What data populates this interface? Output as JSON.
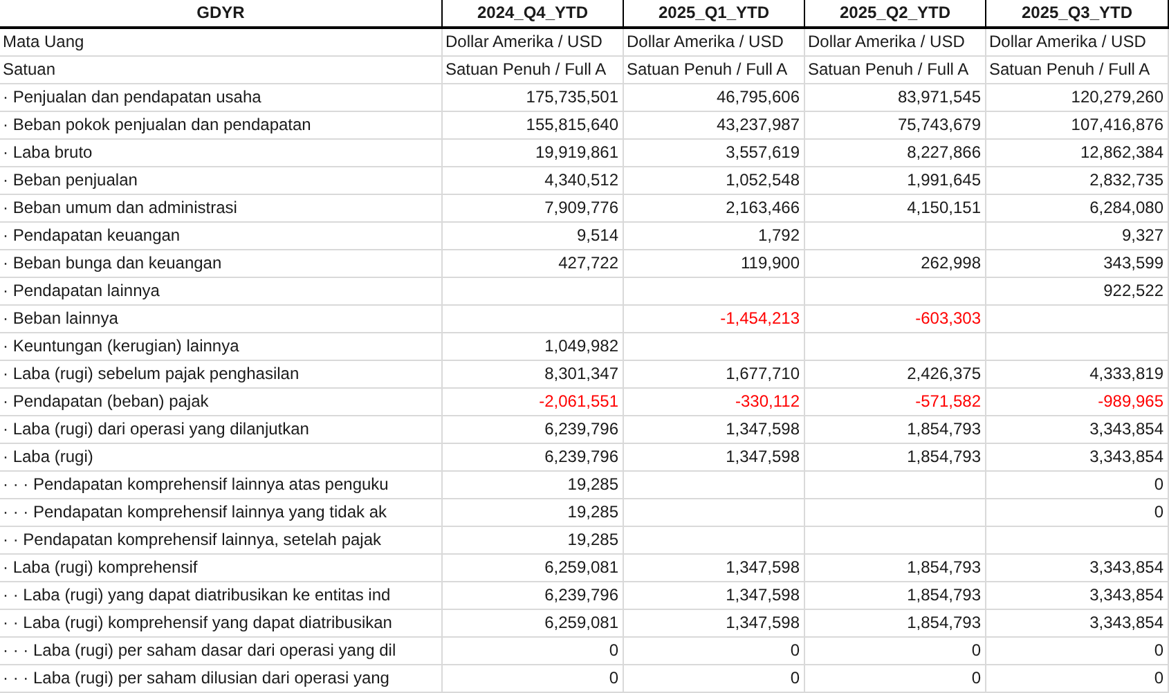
{
  "columns": [
    "GDYR",
    "2024_Q4_YTD",
    "2025_Q1_YTD",
    "2025_Q2_YTD",
    "2025_Q3_YTD"
  ],
  "meta_rows": [
    {
      "label": "Mata Uang",
      "values": [
        "Dollar Amerika / USD",
        "Dollar Amerika / USD",
        "Dollar Amerika / USD",
        "Dollar Amerika / USD"
      ]
    },
    {
      "label": "Satuan",
      "values": [
        "Satuan Penuh / Full A",
        "Satuan Penuh / Full A",
        "Satuan Penuh / Full A",
        "Satuan Penuh / Full A"
      ]
    }
  ],
  "rows": [
    {
      "label": "· Penjualan dan pendapatan usaha",
      "col_1": {
        "text": "175,735,501",
        "negative": false
      },
      "col_2": {
        "text": "46,795,606",
        "negative": false
      },
      "col_3": {
        "text": "83,971,545",
        "negative": false
      },
      "col_4": {
        "text": "120,279,260",
        "negative": false
      }
    },
    {
      "label": "· Beban pokok penjualan dan pendapatan",
      "col_1": {
        "text": "155,815,640",
        "negative": false
      },
      "col_2": {
        "text": "43,237,987",
        "negative": false
      },
      "col_3": {
        "text": "75,743,679",
        "negative": false
      },
      "col_4": {
        "text": "107,416,876",
        "negative": false
      }
    },
    {
      "label": "· Laba bruto",
      "col_1": {
        "text": "19,919,861",
        "negative": false
      },
      "col_2": {
        "text": "3,557,619",
        "negative": false
      },
      "col_3": {
        "text": "8,227,866",
        "negative": false
      },
      "col_4": {
        "text": "12,862,384",
        "negative": false
      }
    },
    {
      "label": "· Beban penjualan",
      "col_1": {
        "text": "4,340,512",
        "negative": false
      },
      "col_2": {
        "text": "1,052,548",
        "negative": false
      },
      "col_3": {
        "text": "1,991,645",
        "negative": false
      },
      "col_4": {
        "text": "2,832,735",
        "negative": false
      }
    },
    {
      "label": "· Beban umum dan administrasi",
      "col_1": {
        "text": "7,909,776",
        "negative": false
      },
      "col_2": {
        "text": "2,163,466",
        "negative": false
      },
      "col_3": {
        "text": "4,150,151",
        "negative": false
      },
      "col_4": {
        "text": "6,284,080",
        "negative": false
      }
    },
    {
      "label": "· Pendapatan keuangan",
      "col_1": {
        "text": "9,514",
        "negative": false
      },
      "col_2": {
        "text": "1,792",
        "negative": false
      },
      "col_4": {
        "text": "9,327",
        "negative": false
      }
    },
    {
      "label": "· Beban bunga dan keuangan",
      "col_1": {
        "text": "427,722",
        "negative": false
      },
      "col_2": {
        "text": "119,900",
        "negative": false
      },
      "col_3": {
        "text": "262,998",
        "negative": false
      },
      "col_4": {
        "text": "343,599",
        "negative": false
      }
    },
    {
      "label": "· Pendapatan lainnya",
      "col_4": {
        "text": "922,522",
        "negative": false
      }
    },
    {
      "label": "· Beban lainnya",
      "col_2": {
        "text": "-1,454,213",
        "negative": true
      },
      "col_3": {
        "text": "-603,303",
        "negative": true
      }
    },
    {
      "label": "· Keuntungan (kerugian) lainnya",
      "col_1": {
        "text": "1,049,982",
        "negative": false
      }
    },
    {
      "label": "· Laba (rugi) sebelum pajak penghasilan",
      "col_1": {
        "text": "8,301,347",
        "negative": false
      },
      "col_2": {
        "text": "1,677,710",
        "negative": false
      },
      "col_3": {
        "text": "2,426,375",
        "negative": false
      },
      "col_4": {
        "text": "4,333,819",
        "negative": false
      }
    },
    {
      "label": "· Pendapatan (beban) pajak",
      "col_1": {
        "text": "-2,061,551",
        "negative": true
      },
      "col_2": {
        "text": "-330,112",
        "negative": true
      },
      "col_3": {
        "text": "-571,582",
        "negative": true
      },
      "col_4": {
        "text": "-989,965",
        "negative": true
      }
    },
    {
      "label": "· Laba (rugi) dari operasi yang dilanjutkan",
      "col_1": {
        "text": "6,239,796",
        "negative": false
      },
      "col_2": {
        "text": "1,347,598",
        "negative": false
      },
      "col_3": {
        "text": "1,854,793",
        "negative": false
      },
      "col_4": {
        "text": "3,343,854",
        "negative": false
      }
    },
    {
      "label": "· Laba (rugi)",
      "col_1": {
        "text": "6,239,796",
        "negative": false
      },
      "col_2": {
        "text": "1,347,598",
        "negative": false
      },
      "col_3": {
        "text": "1,854,793",
        "negative": false
      },
      "col_4": {
        "text": "3,343,854",
        "negative": false
      }
    },
    {
      "label": "· · · Pendapatan komprehensif lainnya atas penguku",
      "col_1": {
        "text": "19,285",
        "negative": false
      },
      "col_4": {
        "text": "0",
        "negative": false
      }
    },
    {
      "label": "· · · Pendapatan komprehensif lainnya yang tidak ak",
      "col_1": {
        "text": "19,285",
        "negative": false
      },
      "col_4": {
        "text": "0",
        "negative": false
      }
    },
    {
      "label": "· · Pendapatan komprehensif lainnya, setelah pajak",
      "col_1": {
        "text": "19,285",
        "negative": false
      }
    },
    {
      "label": "· Laba (rugi) komprehensif",
      "col_1": {
        "text": "6,259,081",
        "negative": false
      },
      "col_2": {
        "text": "1,347,598",
        "negative": false
      },
      "col_3": {
        "text": "1,854,793",
        "negative": false
      },
      "col_4": {
        "text": "3,343,854",
        "negative": false
      }
    },
    {
      "label": "· · Laba (rugi) yang dapat diatribusikan ke entitas ind",
      "col_1": {
        "text": "6,239,796",
        "negative": false
      },
      "col_2": {
        "text": "1,347,598",
        "negative": false
      },
      "col_3": {
        "text": "1,854,793",
        "negative": false
      },
      "col_4": {
        "text": "3,343,854",
        "negative": false
      }
    },
    {
      "label": "· · Laba (rugi) komprehensif yang dapat diatribusikan",
      "col_1": {
        "text": "6,259,081",
        "negative": false
      },
      "col_2": {
        "text": "1,347,598",
        "negative": false
      },
      "col_3": {
        "text": "1,854,793",
        "negative": false
      },
      "col_4": {
        "text": "3,343,854",
        "negative": false
      }
    },
    {
      "label": "· · · Laba (rugi) per saham dasar dari operasi yang dil",
      "col_1": {
        "text": "0",
        "negative": false
      },
      "col_2": {
        "text": "0",
        "negative": false
      },
      "col_3": {
        "text": "0",
        "negative": false
      },
      "col_4": {
        "text": "0",
        "negative": false
      }
    },
    {
      "label": "· · · Laba (rugi) per saham dilusian dari operasi yang",
      "col_1": {
        "text": "0",
        "negative": false
      },
      "col_2": {
        "text": "0",
        "negative": false
      },
      "col_3": {
        "text": "0",
        "negative": false
      },
      "col_4": {
        "text": "0",
        "negative": false
      }
    }
  ]
}
